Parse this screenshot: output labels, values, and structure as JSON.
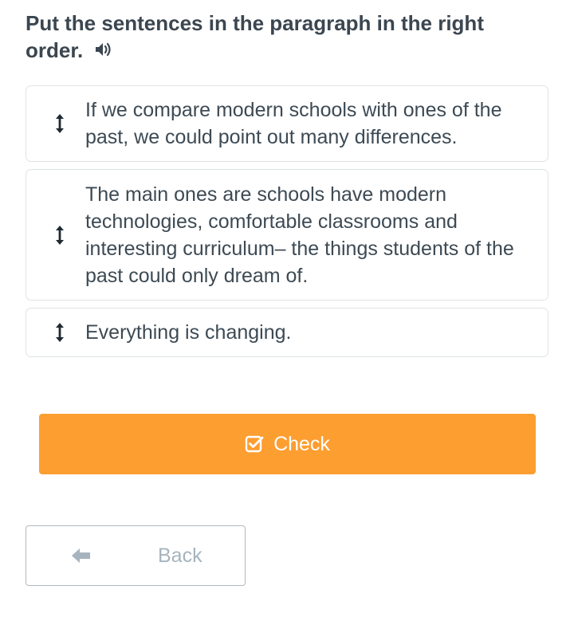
{
  "instruction": {
    "text": "Put the sentences in the paragraph in the right order.",
    "audio_icon": "speaker-icon"
  },
  "sentences": [
    {
      "text": "If we compare modern schools with ones of the past, we could point out many differences.",
      "icon": "drag-handle-icon"
    },
    {
      "text": "The main ones are schools have modern technologies, comfortable classrooms and interesting curriculum– the things students of the past could only dream of.",
      "icon": "drag-handle-icon"
    },
    {
      "text": "Everything is changing.",
      "icon": "drag-handle-icon"
    }
  ],
  "check_button": {
    "label": "Check",
    "icon": "checkbox-checked-icon",
    "color": "#fd9e31"
  },
  "back_button": {
    "label": "Back",
    "icon": "arrow-left-icon"
  },
  "colors": {
    "text": "#3d4a54",
    "card_border": "#dfe3e6",
    "muted": "#a6b4bf"
  }
}
